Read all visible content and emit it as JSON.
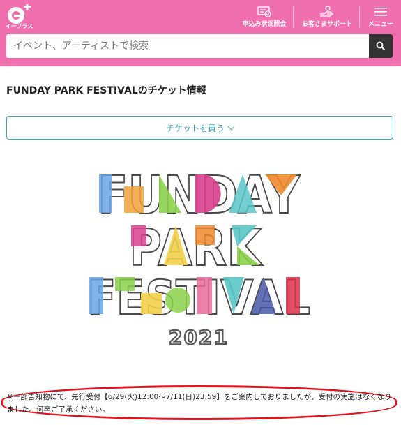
{
  "header": {
    "logo_text": "イープラス",
    "nav": [
      {
        "label": "申込み状況照会",
        "icon": "ticket-check-icon"
      },
      {
        "label": "お客さまサポート",
        "icon": "support-hand-icon"
      },
      {
        "label": "メニュー",
        "icon": "hamburger-menu-icon"
      }
    ],
    "brand_color": "#f06fae"
  },
  "search": {
    "placeholder": "イベント、アーティストで検索",
    "button_icon": "search-icon"
  },
  "page": {
    "title": "FUNDAY PARK FESTIVALのチケット情報",
    "buy_button": "チケットを買う"
  },
  "festival_logo": {
    "lines": [
      "FUNDAY",
      "PARK",
      "FESTIVAL"
    ],
    "year": "2021"
  },
  "notice": {
    "text": "※一部告知物にて、先行受付【6/29(火)12:00〜7/11(日)23:59】をご案内しておりましたが、受付の実施はなくなりました。何卒ご了承ください。",
    "highlight_color": "#e0141e"
  }
}
